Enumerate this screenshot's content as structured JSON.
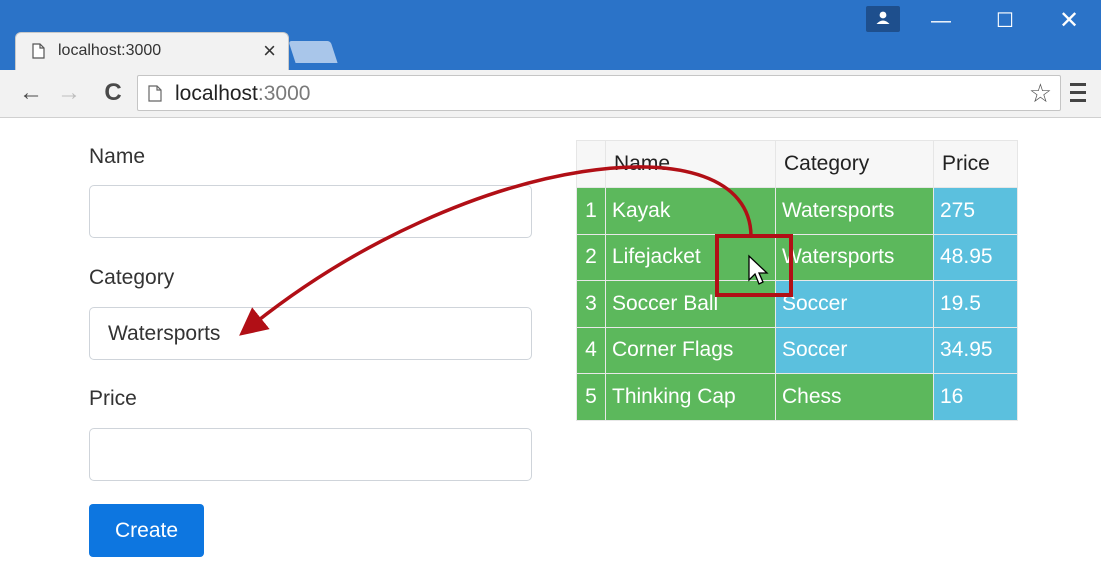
{
  "browser": {
    "tab_title": "localhost:3000",
    "tab_close": "×",
    "url_host": "localhost",
    "url_port": ":3000",
    "star": "☆",
    "back": "←",
    "forward": "→",
    "reload": "C",
    "window_min": "—",
    "window_max": "☐",
    "window_close": "✕"
  },
  "form": {
    "name_label": "Name",
    "name_value": "",
    "category_label": "Category",
    "category_value": "Watersports",
    "price_label": "Price",
    "price_value": "",
    "create_label": "Create"
  },
  "table": {
    "headers": [
      "",
      "Name",
      "Category",
      "Price"
    ],
    "rows": [
      {
        "index": "1",
        "name": "Kayak",
        "category": "Watersports",
        "price": "275",
        "name_color": "green",
        "category_color": "green",
        "price_color": "blue"
      },
      {
        "index": "2",
        "name": "Lifejacket",
        "category": "Watersports",
        "price": "48.95",
        "name_color": "green",
        "category_color": "green",
        "price_color": "blue"
      },
      {
        "index": "3",
        "name": "Soccer Ball",
        "category": "Soccer",
        "price": "19.5",
        "name_color": "green",
        "category_color": "blue",
        "price_color": "blue"
      },
      {
        "index": "4",
        "name": "Corner Flags",
        "category": "Soccer",
        "price": "34.95",
        "name_color": "green",
        "category_color": "blue",
        "price_color": "blue"
      },
      {
        "index": "5",
        "name": "Thinking Cap",
        "category": "Chess",
        "price": "16",
        "name_color": "green",
        "category_color": "green",
        "price_color": "blue"
      }
    ]
  },
  "colors": {
    "titlebar": "#2b73c8",
    "green_cell": "#5cb85c",
    "blue_cell": "#5bc0de",
    "primary_button": "#0d76e0",
    "annotation": "#b10f16"
  }
}
